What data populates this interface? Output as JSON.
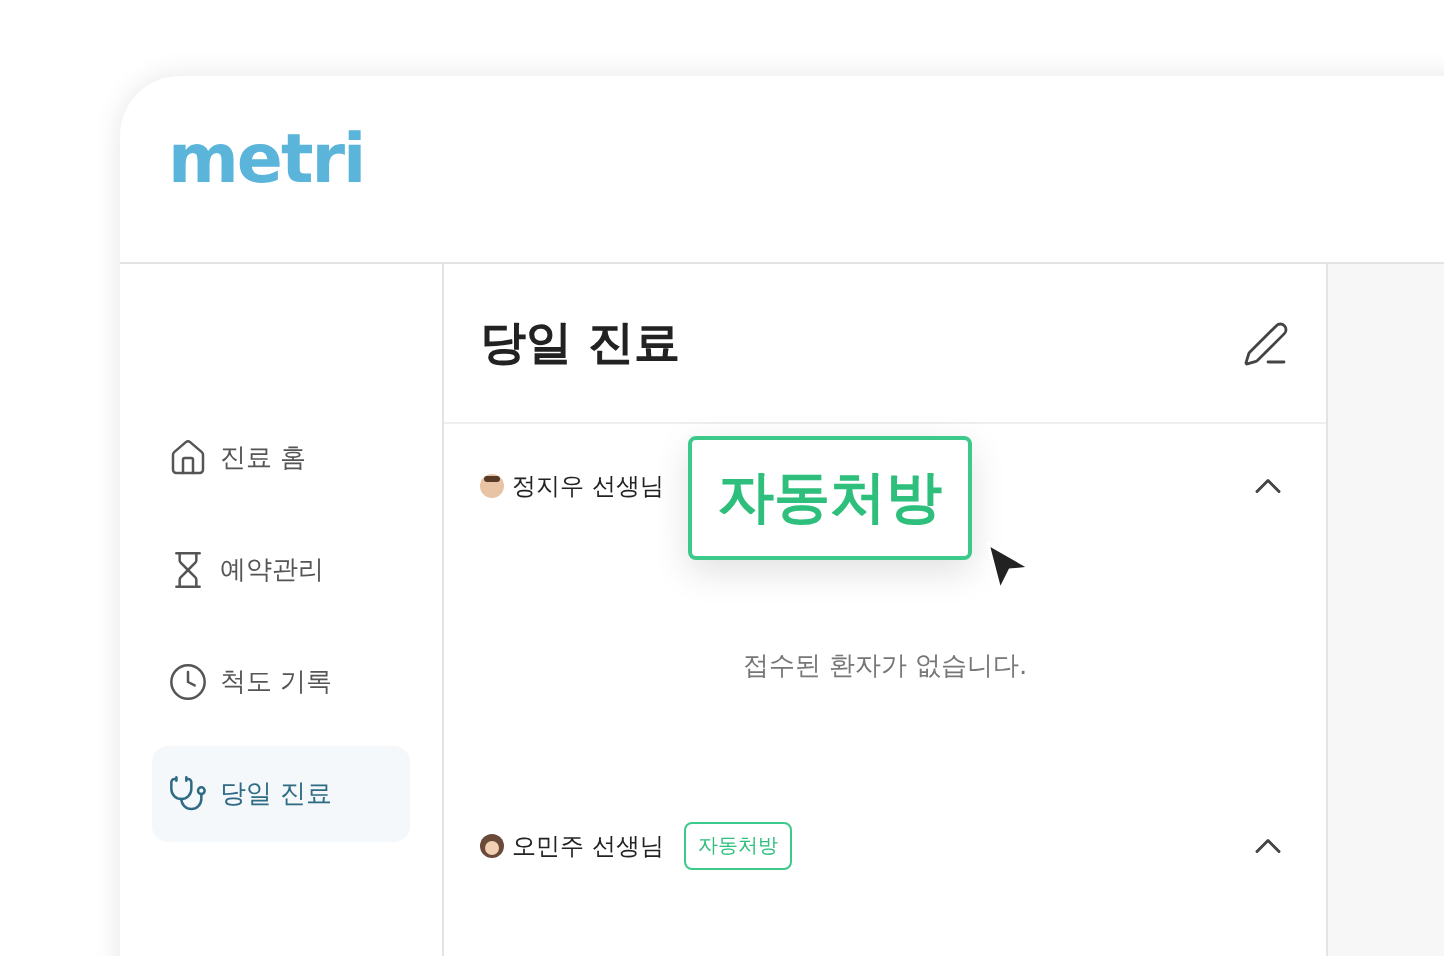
{
  "logo": "metri",
  "nav": [
    {
      "label": "진료 홈",
      "selected": false
    },
    {
      "label": "예약관리",
      "selected": false
    },
    {
      "label": "척도 기록",
      "selected": false
    },
    {
      "label": "당일 진료",
      "selected": true
    }
  ],
  "panel": {
    "title": "당일 진료"
  },
  "doctors": [
    {
      "name": "정지우 선생님",
      "expanded": true,
      "callout": "자동처방",
      "empty_message": "접수된 환자가 없습니다."
    },
    {
      "name": "오민주 선생님",
      "expanded": true,
      "badge": "자동처방"
    }
  ]
}
